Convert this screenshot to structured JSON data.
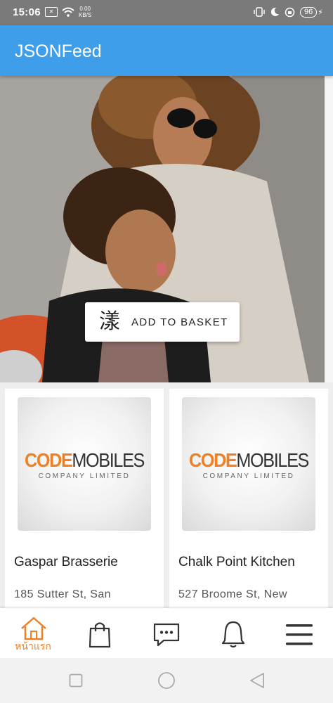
{
  "status": {
    "time": "15:06",
    "speed_value": "0.00",
    "speed_unit": "KB/S",
    "battery": "96"
  },
  "app": {
    "title": "JSONFeed"
  },
  "hero": {
    "image_name": "mother-and-child-on-scooter",
    "add_to_basket": {
      "icon": "漾",
      "label": "ADD TO BASKET"
    }
  },
  "cards": [
    {
      "logo_accent": "CODE",
      "logo_main": "MOBILES",
      "logo_sub": "COMPANY LIMITED",
      "name": "Gaspar Brasserie",
      "address": "185 Sutter St, San"
    },
    {
      "logo_accent": "CODE",
      "logo_main": "MOBILES",
      "logo_sub": "COMPANY LIMITED",
      "name": "Chalk Point Kitchen",
      "address": "527 Broome St, New"
    }
  ],
  "bottom_nav": {
    "home_label": "หน้าแรก",
    "icons": [
      "home-icon",
      "shopping-bag-icon",
      "chat-icon",
      "bell-icon",
      "menu-icon"
    ]
  },
  "colors": {
    "app_bar": "#3e9ee9",
    "accent": "#f08024",
    "status_bar": "#7a7a7a"
  }
}
